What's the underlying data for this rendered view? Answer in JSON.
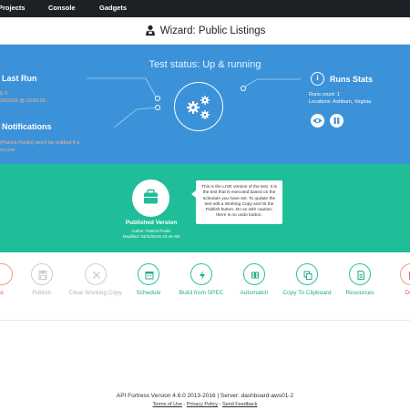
{
  "nav": {
    "items": [
      {
        "label": "Projects"
      },
      {
        "label": "Console"
      },
      {
        "label": "Gadgets"
      }
    ]
  },
  "page": {
    "title": "Wizard: Public Listings"
  },
  "status": {
    "title": "Test status: Up & running",
    "last_run": {
      "heading": "Last Run",
      "line1": "E 0",
      "line2": "20/2016 @ 10:50:02"
    },
    "notifications": {
      "heading": "Notifications",
      "line1": "(Patrick Poulin) won't be notified if a",
      "line2": "occurs"
    },
    "runs_stats": {
      "heading": "Runs Stats",
      "runs_count": "Runs count: 1",
      "locations": "Locations: Ashburn, Virginia"
    }
  },
  "published": {
    "title": "Published Version",
    "author": "Author: Patrick Poulin",
    "modified": "Modified: 03/22/2016 10:40 AM",
    "tooltip": "This is the LIVE version of the test. It is the test that is executed based on the schedule you have set. To update the test edit a Working Copy and hit the Publish button. Do so with caution; there is no undo button."
  },
  "actions": [
    {
      "label": "e",
      "icon": "delete-icon",
      "state": "danger"
    },
    {
      "label": "Publish",
      "icon": "publish-icon",
      "state": "disabled"
    },
    {
      "label": "Clear Working Copy",
      "icon": "clear-icon",
      "state": "disabled"
    },
    {
      "label": "Schedule",
      "icon": "calendar-icon",
      "state": "enabled"
    },
    {
      "label": "Build from SPEC",
      "icon": "bolt-icon",
      "state": "enabled"
    },
    {
      "label": "Automatch",
      "icon": "automatch-icon",
      "state": "enabled"
    },
    {
      "label": "Copy To Clipboard",
      "icon": "copy-icon",
      "state": "enabled"
    },
    {
      "label": "Resources",
      "icon": "file-icon",
      "state": "enabled"
    },
    {
      "label": "Dele",
      "icon": "delete-icon",
      "state": "enabled"
    }
  ],
  "footer": {
    "version": "API Fortress Version 4.6.0 2013-2016 | Server: dashboard-aws01-2",
    "links": [
      {
        "label": "Terms of Use"
      },
      {
        "label": "Privacy Policy"
      },
      {
        "label": "Send Feedback"
      }
    ],
    "separator": " - "
  },
  "colors": {
    "blue_panel": "#3c92d8",
    "green_panel": "#1fbe98",
    "nav_bg": "#1d2126",
    "accent_orange": "#f6b48a"
  }
}
